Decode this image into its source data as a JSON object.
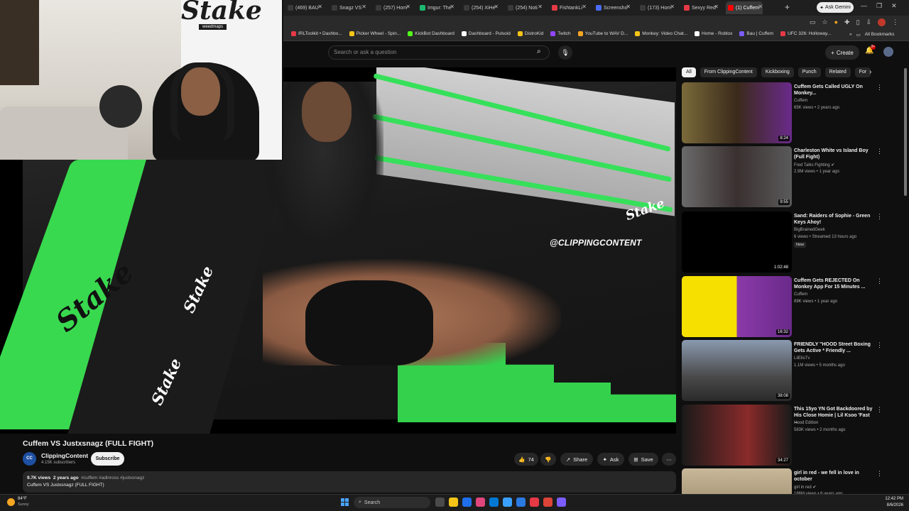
{
  "browser": {
    "tabs": [
      {
        "label": "(469) BAU",
        "color": "#3a3a3a",
        "active": false
      },
      {
        "label": "Snagz VS",
        "color": "#3a3a3a",
        "active": false
      },
      {
        "label": "(257) Hom",
        "color": "#3a3a3a",
        "active": false
      },
      {
        "label": "Imgur: The",
        "color": "#1bb76e",
        "active": false
      },
      {
        "label": "(254) XiHe",
        "color": "#3a3a3a",
        "active": false
      },
      {
        "label": "(254) Noti",
        "color": "#3a3a3a",
        "active": false
      },
      {
        "label": "FishtankLi",
        "color": "#e63946",
        "active": false
      },
      {
        "label": "Screensho",
        "color": "#4a6cf7",
        "active": false
      },
      {
        "label": "(173) Hom",
        "color": "#3a3a3a",
        "active": false
      },
      {
        "label": "Sexyy Red",
        "color": "#e63946",
        "active": false
      },
      {
        "label": "(1) Cuffem",
        "color": "#ff0000",
        "active": true
      }
    ],
    "new_tab": "+",
    "ask_gemini": "Ask Gemini",
    "bookmarks": [
      {
        "label": "IRLToolkit • Dashbo...",
        "color": "#e63946"
      },
      {
        "label": "Picker Wheel - Spin...",
        "color": "#f5c518"
      },
      {
        "label": "KickBot Dashboard",
        "color": "#53fc18"
      },
      {
        "label": "Dashboard - Pulsoid",
        "color": "#ffffff"
      },
      {
        "label": "DistroKid",
        "color": "#f5c518"
      },
      {
        "label": "Twitch",
        "color": "#9146ff"
      },
      {
        "label": "YouTube to WAV D...",
        "color": "#f5a623"
      },
      {
        "label": "Monkey: Video Chat...",
        "color": "#f5c518"
      },
      {
        "label": "Home - Roblox",
        "color": "#ffffff"
      },
      {
        "label": "Bau | Cuffem",
        "color": "#7b5cff"
      },
      {
        "label": "UFC 326: Holloway...",
        "color": "#e63946"
      }
    ],
    "all_bookmarks": "All Bookmarks"
  },
  "yt_header": {
    "search_placeholder": "Search or ask a question",
    "create_label": "Create",
    "notification_count": "9+"
  },
  "video": {
    "watermark": "@CLIPPINGCONTENT",
    "webcam_sign": "Stake",
    "webcam_sub": "weedmaps",
    "ring_brand": "Stake"
  },
  "video_info": {
    "title": "Cuffem VS Justxsnagz (FULL FIGHT)",
    "channel": "ClippingContent",
    "channel_avatar": "CC",
    "subscribers": "4.15K subscribers",
    "subscribe_label": "Subscribe",
    "like_count": "74",
    "share_label": "Share",
    "ask_label": "Ask",
    "save_label": "Save",
    "views": "9.7K views",
    "age": "2 years ago",
    "tags": "#cuffem #adinross #justxsnagz",
    "description_line": "Cuffem VS Justxsnagz (FULL FIGHT)"
  },
  "chips": [
    "All",
    "From ClippingContent",
    "Kickboxing",
    "Punch",
    "Related",
    "For"
  ],
  "related": [
    {
      "title": "Cuffem Gets Called UGLY On Monkey...",
      "channel": "Cuffem",
      "meta": "65K views • 2 years ago",
      "duration": "8:24",
      "verified": false,
      "badge": "",
      "thumb": "linear-gradient(90deg,#7a6a3a 0%,#3a2a1a 50%,#6a2a8a 100%)"
    },
    {
      "title": "Charleston White vs Island Boy (Full Fight)",
      "channel": "Fred Talks Fighting",
      "meta": "2.9M views • 1 year ago",
      "duration": "9:55",
      "verified": true,
      "badge": "",
      "thumb": "linear-gradient(90deg,#6a6a6a 0%,#3a3030 50%,#5a5a5a 100%)"
    },
    {
      "title": "Sand: Raiders of Sophie - Green Keys Ahoy!",
      "channel": "BigBrainedGeek",
      "meta": "6 views • Streamed 13 hours ago",
      "duration": "1:02:48",
      "verified": false,
      "badge": "New",
      "thumb": "#000000"
    },
    {
      "title": "Cuffem Gets REJECTED On Monkey App For 15 Minutes ...",
      "channel": "Cuffem",
      "meta": "89K views • 1 year ago",
      "duration": "16:32",
      "verified": false,
      "badge": "",
      "thumb": "linear-gradient(90deg,#f5e000 0%,#f5e000 50%,#8a3aa8 50%,#6a2a8a 100%)"
    },
    {
      "title": "FRIENDLY \"HOOD Street Boxing Gets Active * Friendly ...",
      "channel": "LilElisTv",
      "meta": "1.1M views • 5 months ago",
      "duration": "38:08",
      "verified": false,
      "badge": "",
      "thumb": "linear-gradient(180deg,#8a9ab0 0%,#4a4a4a 60%,#2a2a2a 100%)"
    },
    {
      "title": "This 15yo YN Got Backdoored by His Close Homie | Lil Ksoo 'Fast ...",
      "channel": "Hood Edition",
      "meta": "583K views • 2 months ago",
      "duration": "34:27",
      "verified": false,
      "badge": "",
      "thumb": "linear-gradient(90deg,#1a1a1a 0%,#8a2a2a 60%,#1a1a1a 100%)"
    },
    {
      "title": "girl in red - we fell in love in october",
      "channel": "girl in red",
      "meta": "186M views • 6 years ago",
      "duration": "",
      "verified": true,
      "badge": "",
      "thumb": "linear-gradient(180deg,#c8b89a 0%,#8a7a5a 100%)"
    }
  ],
  "taskbar": {
    "temp": "84°F",
    "condition": "Sunny",
    "search_label": "Search",
    "time": "12:42 PM",
    "date": "8/6/2026",
    "apps": [
      "#4a4a4a",
      "#f5c518",
      "#1f6feb",
      "#e0457b",
      "#0078d4",
      "#3aa0ff",
      "#2a7ae2",
      "#e63946",
      "#db4437",
      "#7b5cff"
    ]
  }
}
